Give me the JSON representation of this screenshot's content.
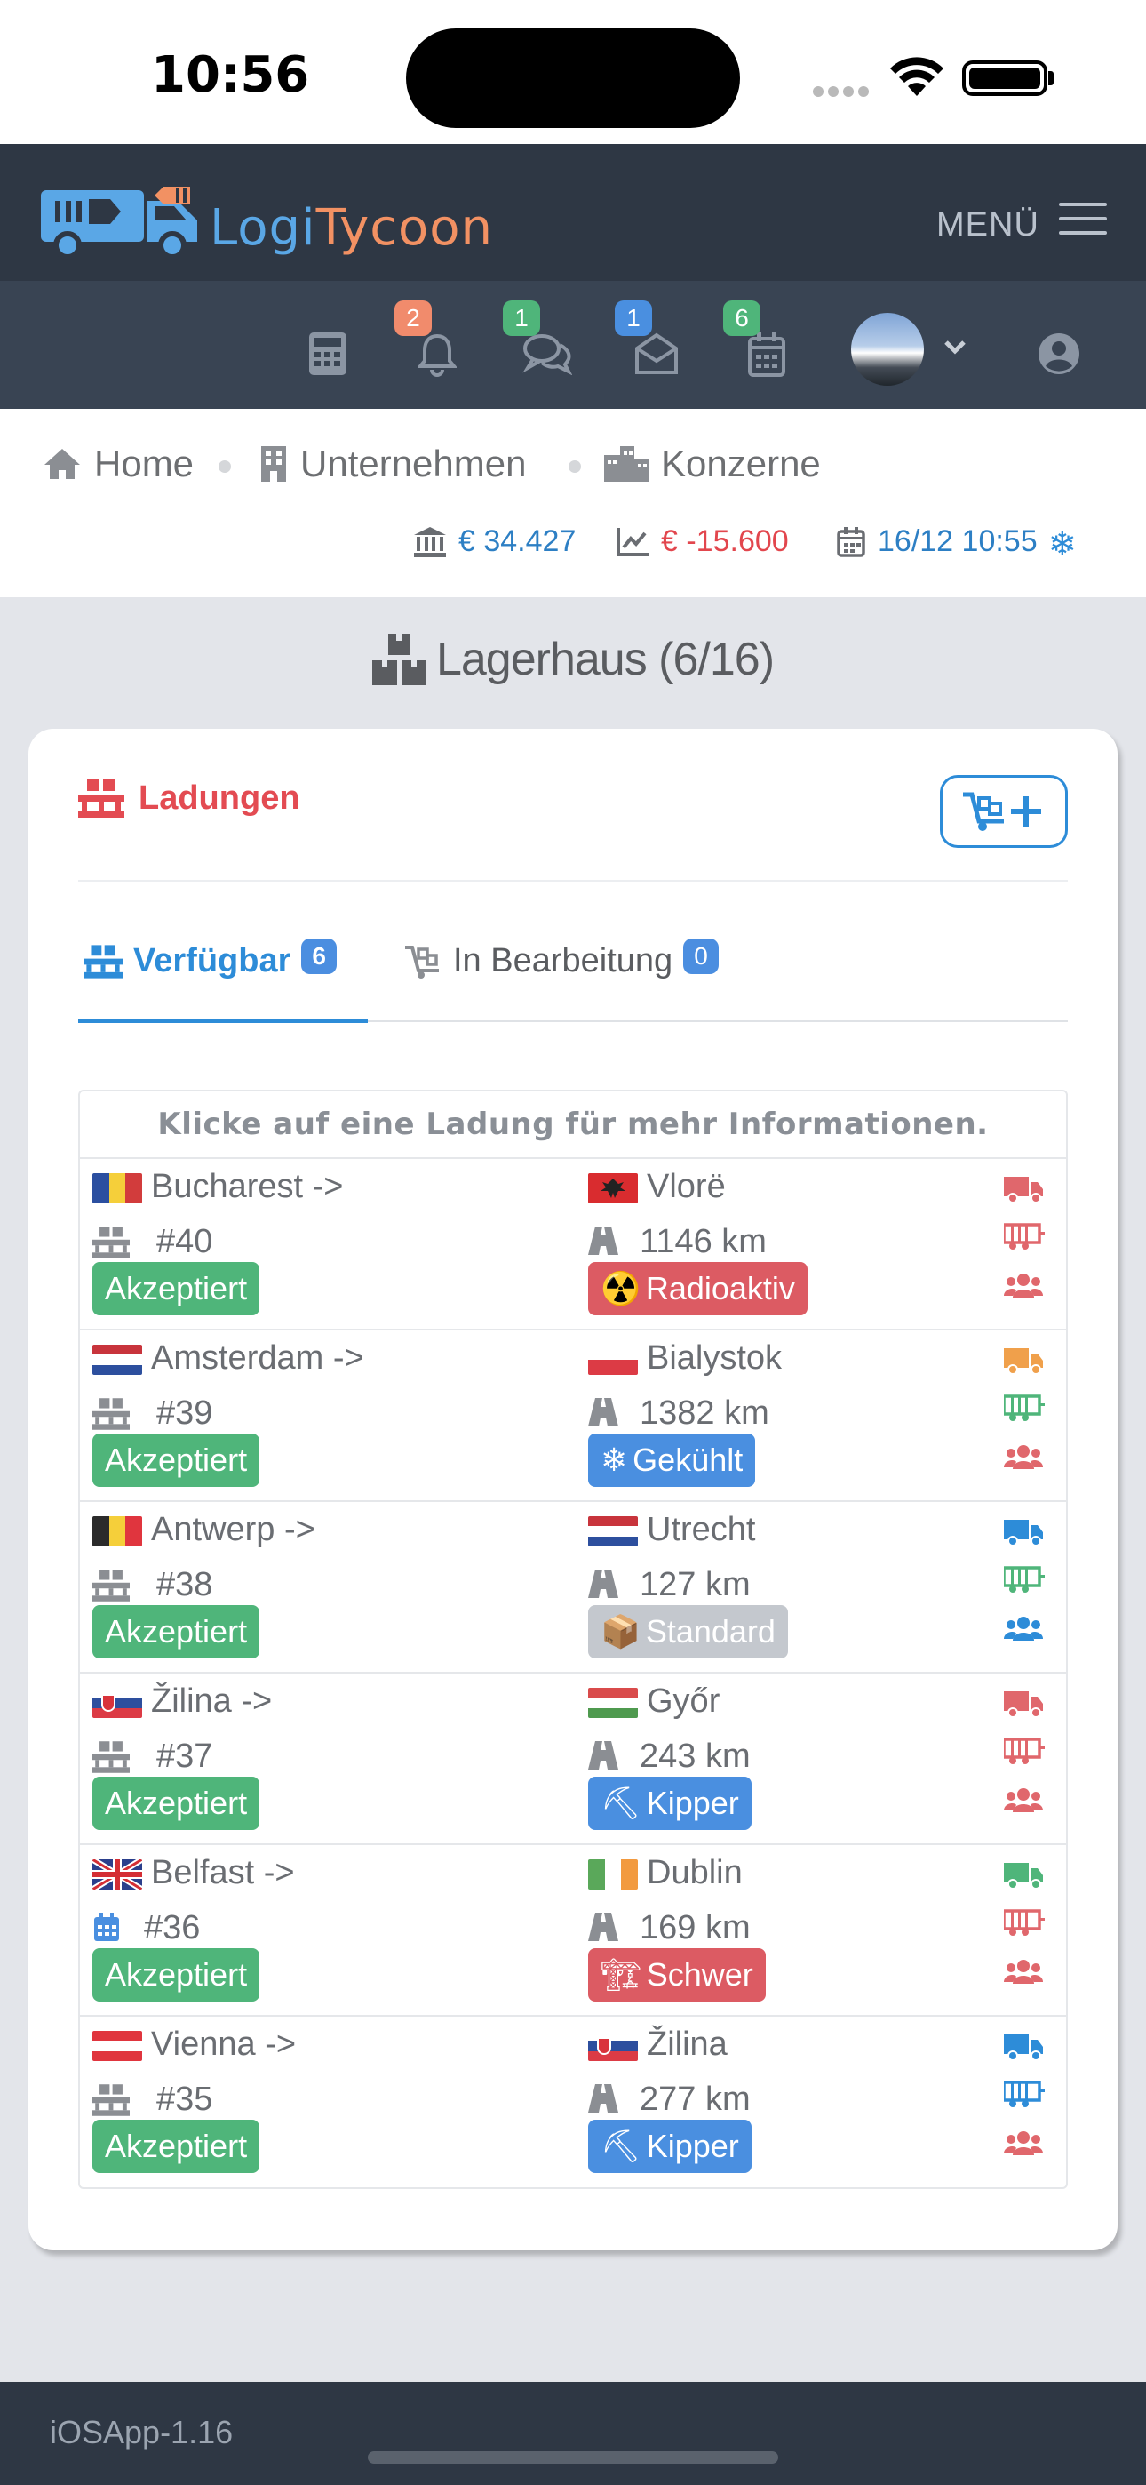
{
  "status_bar": {
    "time": "10:56"
  },
  "app": {
    "logo_part1": "Logi",
    "logo_part2": "Tycoon",
    "menu_label": "MENÜ"
  },
  "toolbar": {
    "notifications_count": "2",
    "messages_count": "1",
    "mail_count": "1",
    "calendar_count": "6"
  },
  "breadcrumb": {
    "home": "Home",
    "company": "Unternehmen",
    "group": "Konzerne"
  },
  "stats": {
    "balance": "€ 34.427",
    "profit": "€ -15.600",
    "datetime": "16/12 10:55"
  },
  "page": {
    "title": "Lagerhaus (6/16)"
  },
  "card": {
    "title": "Ladungen",
    "tabs": [
      {
        "label": "Verfügbar",
        "count": "6"
      },
      {
        "label": "In Bearbeitung",
        "count": "0"
      }
    ],
    "hint": "Klicke auf eine Ladung für mehr Informationen."
  },
  "loads": [
    {
      "from": "Bucharest ->",
      "to": "Vlorë",
      "id": "#40",
      "distance": "1146 km",
      "status": "Akzeptiert",
      "cargo": "Radioaktiv",
      "cargo_emoji": "☢️",
      "cargo_color": "#dc5b63",
      "truck_color": "#e0676c",
      "trailer_color": "#e0676c",
      "driver_color": "#e0676c",
      "from_flag": "RO",
      "to_flag": "AL",
      "id_icon": "pallet-icon"
    },
    {
      "from": "Amsterdam ->",
      "to": "Bialystok",
      "id": "#39",
      "distance": "1382 km",
      "status": "Akzeptiert",
      "cargo": "Gekühlt",
      "cargo_emoji": "❄",
      "cargo_color": "#4a8fe0",
      "truck_color": "#f0a04b",
      "trailer_color": "#4fb57a",
      "driver_color": "#e0676c",
      "from_flag": "NL",
      "to_flag": "PL",
      "id_icon": "pallet-icon"
    },
    {
      "from": "Antwerp ->",
      "to": "Utrecht",
      "id": "#38",
      "distance": "127 km",
      "status": "Akzeptiert",
      "cargo": "Standard",
      "cargo_emoji": "📦",
      "cargo_color": "#c4c8ce",
      "truck_color": "#2d8cd8",
      "trailer_color": "#4fb57a",
      "driver_color": "#2d8cd8",
      "from_flag": "BE",
      "to_flag": "NL",
      "id_icon": "pallet-icon"
    },
    {
      "from": "Žilina ->",
      "to": "Győr",
      "id": "#37",
      "distance": "243 km",
      "status": "Akzeptiert",
      "cargo": "Kipper",
      "cargo_emoji": "⛏",
      "cargo_color": "#4a8fe0",
      "truck_color": "#e0676c",
      "trailer_color": "#e0676c",
      "driver_color": "#e0676c",
      "from_flag": "SK",
      "to_flag": "HU",
      "id_icon": "pallet-icon"
    },
    {
      "from": "Belfast ->",
      "to": "Dublin",
      "id": "#36",
      "distance": "169 km",
      "status": "Akzeptiert",
      "cargo": "Schwer",
      "cargo_emoji": "🏗",
      "cargo_color": "#dc5b63",
      "truck_color": "#4fb57a",
      "trailer_color": "#e0676c",
      "driver_color": "#e0676c",
      "from_flag": "GB",
      "to_flag": "IE",
      "id_icon": "calendar-icon"
    },
    {
      "from": "Vienna ->",
      "to": "Žilina",
      "id": "#35",
      "distance": "277 km",
      "status": "Akzeptiert",
      "cargo": "Kipper",
      "cargo_emoji": "⛏",
      "cargo_color": "#4a8fe0",
      "truck_color": "#2d8cd8",
      "trailer_color": "#2d8cd8",
      "driver_color": "#e0676c",
      "from_flag": "AT",
      "to_flag": "SK",
      "id_icon": "pallet-icon"
    }
  ],
  "footer": {
    "version": "iOSApp-1.16"
  }
}
